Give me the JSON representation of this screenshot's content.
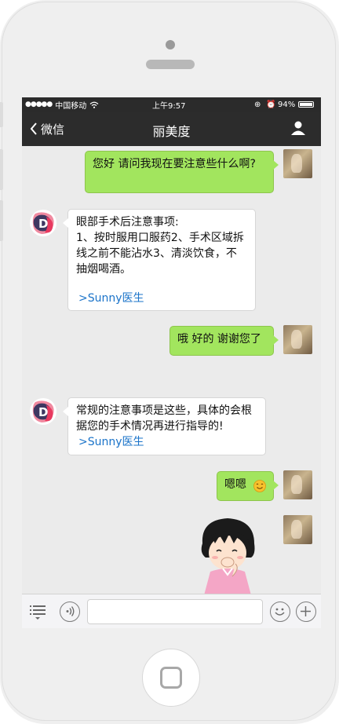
{
  "status_bar": {
    "carrier": "中国移动",
    "time": "上午9:57",
    "battery": "94%"
  },
  "nav": {
    "back_label": "微信",
    "title": "丽美度"
  },
  "messages": [
    {
      "side": "right",
      "text": "您好 请问我现在要注意些什么啊?"
    },
    {
      "side": "left",
      "text": "眼部手术后注意事项:\n1、按时服用口服药2、手术区域拆线之前不能沾水3、清淡饮食，不抽烟喝酒。",
      "link": ">Sunny医生"
    },
    {
      "side": "right",
      "text": "哦 好的 谢谢您了"
    },
    {
      "side": "left",
      "text": "常规的注意事项是这些，具体的会根据您的手术情况再进行指导的!",
      "link": ">Sunny医生"
    },
    {
      "side": "right",
      "text": "嗯嗯"
    }
  ],
  "input": {
    "placeholder": ""
  },
  "colors": {
    "my_bubble": "#a2e55e",
    "their_bubble": "#ffffff",
    "nav_bg": "#2c2c2c",
    "link": "#1a73c9"
  }
}
